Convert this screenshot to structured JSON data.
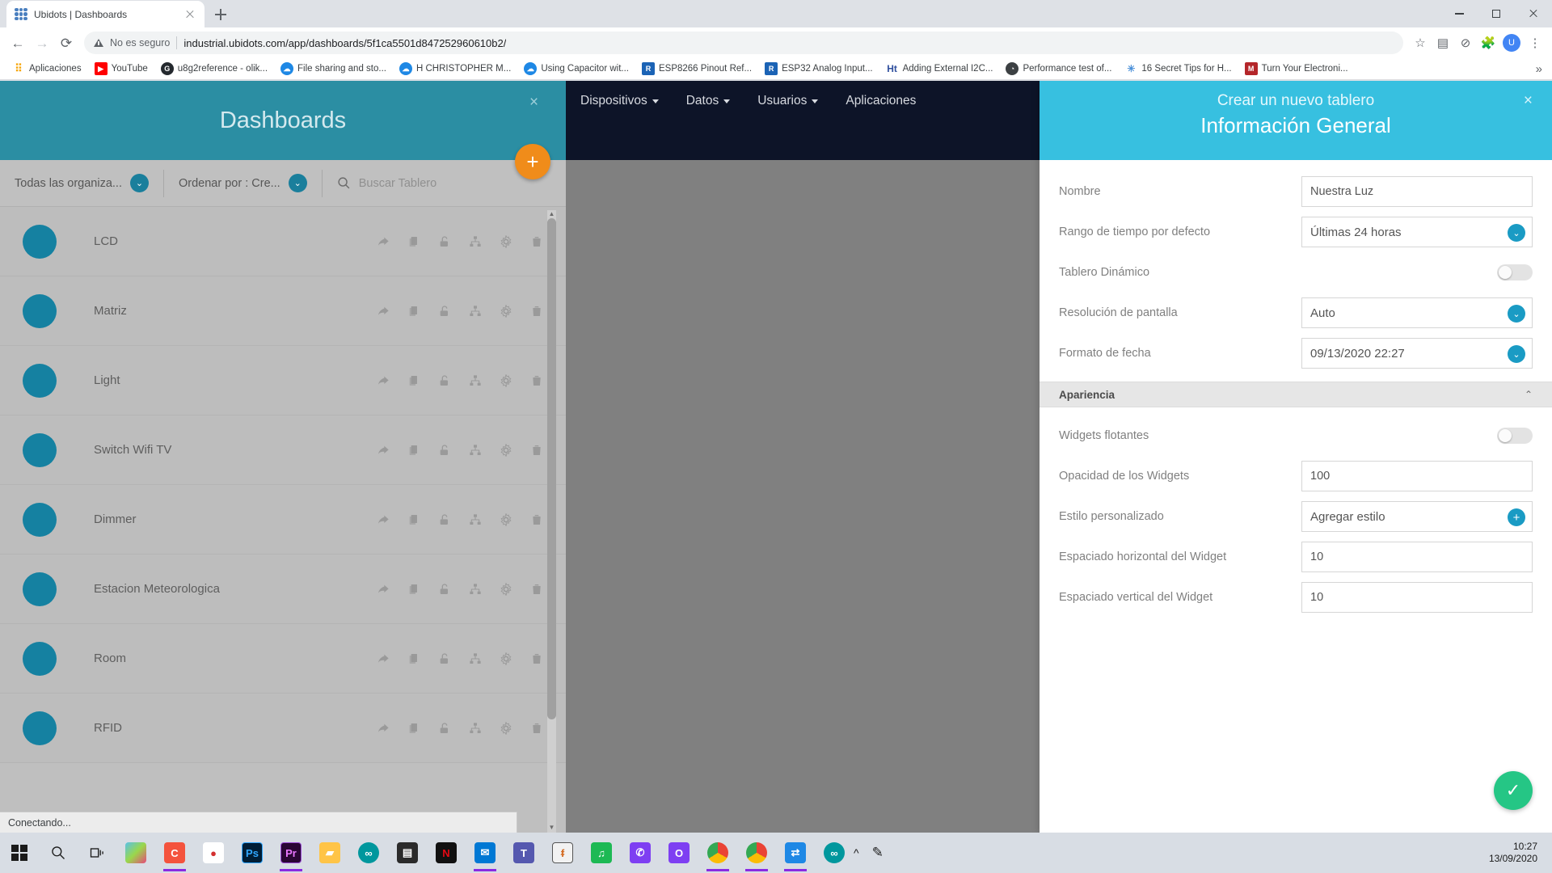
{
  "browser": {
    "tab": {
      "title": "Ubidots | Dashboards",
      "favicon": "ubidots-dots-icon",
      "close": "×"
    },
    "new_tab_tooltip": "+",
    "window_controls": {
      "minimize": "minimize-icon",
      "maximize": "maximize-icon",
      "close": "close-icon"
    },
    "omnibox": {
      "security_label": "No es seguro",
      "url": "industrial.ubidots.com/app/dashboards/5f1ca5501d847252960610b2/",
      "star": "☆",
      "avatar_initial": "U"
    },
    "bookmarks": [
      {
        "label": "Aplicaciones",
        "icon": "apps-grid-icon",
        "color": "#f6a609"
      },
      {
        "label": "YouTube",
        "icon": "youtube-icon",
        "color": "#ff0000"
      },
      {
        "label": "u8g2reference - olik...",
        "icon": "github-icon",
        "color": "#24292e"
      },
      {
        "label": "File sharing and sto...",
        "icon": "cloud-icon",
        "color": "#1e88e5"
      },
      {
        "label": "H CHRISTOPHER M...",
        "icon": "cloud-icon",
        "color": "#1e88e5"
      },
      {
        "label": "Using Capacitor wit...",
        "icon": "cloud-icon",
        "color": "#1e88e5"
      },
      {
        "label": "ESP8266 Pinout Ref...",
        "icon": "page-icon",
        "color": "#1b63b5"
      },
      {
        "label": "ESP32 Analog Input...",
        "icon": "page-icon",
        "color": "#1b63b5"
      },
      {
        "label": "Adding External I2C...",
        "icon": "h-icon",
        "color": "#2f4f9e"
      },
      {
        "label": "Performance test of...",
        "icon": "circle-icon",
        "color": "#3c4043"
      },
      {
        "label": "16 Secret Tips for H...",
        "icon": "star-burst-icon",
        "color": "#4a90d9"
      },
      {
        "label": "Turn Your Electroni...",
        "icon": "m-icon",
        "color": "#b4262a"
      }
    ],
    "overflow": "»"
  },
  "page": {
    "navbar": {
      "items": [
        {
          "label": "Dispositivos",
          "has_caret": true
        },
        {
          "label": "Datos",
          "has_caret": true
        },
        {
          "label": "Usuarios",
          "has_caret": true
        },
        {
          "label": "Aplicaciones",
          "has_caret": false
        }
      ]
    },
    "drawer": {
      "title": "Dashboards",
      "close": "×",
      "add_button": "+",
      "filters": [
        {
          "label": "Todas las organiza...",
          "chevron": "⌄"
        },
        {
          "label": "Ordenar por : Cre...",
          "chevron": "⌄"
        }
      ],
      "search": {
        "placeholder": "Buscar Tablero",
        "value": "",
        "icon": "search-icon"
      },
      "row_actions": [
        "share-icon",
        "duplicate-icon",
        "unlock-icon",
        "hierarchy-icon",
        "gear-icon",
        "trash-icon"
      ],
      "items": [
        {
          "name": "LCD"
        },
        {
          "name": "Matriz"
        },
        {
          "name": "Light"
        },
        {
          "name": "Switch Wifi TV"
        },
        {
          "name": "Dimmer"
        },
        {
          "name": "Estacion Meteorologica"
        },
        {
          "name": "Room"
        },
        {
          "name": "RFID"
        }
      ]
    },
    "right_panel": {
      "subtitle": "Crear un nuevo tablero",
      "title": "Información General",
      "close": "×",
      "fields": [
        {
          "label": "Nombre",
          "type": "text",
          "value": "Nuestra Luz"
        },
        {
          "label": "Rango de tiempo por defecto",
          "type": "select",
          "value": "Últimas 24 horas"
        },
        {
          "label": "Tablero Dinámico",
          "type": "toggle",
          "value": "off"
        },
        {
          "label": "Resolución de pantalla",
          "type": "select",
          "value": "Auto"
        },
        {
          "label": "Formato de fecha",
          "type": "select",
          "value": "09/13/2020 22:27"
        }
      ],
      "section": {
        "title": "Apariencia",
        "chevron": "⌃"
      },
      "appearance_fields": [
        {
          "label": "Widgets flotantes",
          "type": "toggle",
          "value": "off"
        },
        {
          "label": "Opacidad de los Widgets",
          "type": "text",
          "value": "100"
        },
        {
          "label": "Estilo personalizado",
          "type": "add",
          "value": "Agregar estilo"
        },
        {
          "label": "Espaciado horizontal del Widget",
          "type": "text",
          "value": "10"
        },
        {
          "label": "Espaciado vertical del Widget",
          "type": "text",
          "value": "10"
        }
      ],
      "save_button": "✓"
    },
    "status_text": "Conectando..."
  },
  "taskbar": {
    "start": "windows-start-icon",
    "search": "search-icon",
    "task_view": "task-view-icon",
    "apps": [
      {
        "name": "paint-3d",
        "label": "",
        "color": "#ffffff",
        "active": false
      },
      {
        "name": "c-app",
        "label": "C",
        "color": "#f4533d",
        "active": true
      },
      {
        "name": "red-drop-app",
        "label": "",
        "color": "#ffffff",
        "active": false
      },
      {
        "name": "photoshop",
        "label": "Ps",
        "color": "#001e36",
        "active": false
      },
      {
        "name": "premiere",
        "label": "Pr",
        "color": "#2a0634",
        "active": true
      },
      {
        "name": "file-explorer",
        "label": "",
        "color": "#ffc447",
        "active": false
      },
      {
        "name": "arduino",
        "label": "∞",
        "color": "#00979d",
        "active": false
      },
      {
        "name": "microsoft-store",
        "label": "",
        "color": "#2b2b2b",
        "active": false
      },
      {
        "name": "netflix",
        "label": "N",
        "color": "#111111",
        "active": false
      },
      {
        "name": "mail",
        "label": "",
        "color": "#0078d4",
        "active": true
      },
      {
        "name": "teams",
        "label": "T",
        "color": "#5558af",
        "active": false
      },
      {
        "name": "fritzing",
        "label": "",
        "color": "#f2f2f2",
        "active": false
      },
      {
        "name": "spotify",
        "label": "",
        "color": "#1db954",
        "active": false
      },
      {
        "name": "whatsapp",
        "label": "",
        "color": "#7e3ff2",
        "active": false
      },
      {
        "name": "outlook-app",
        "label": "O",
        "color": "#7e3ff2",
        "active": false
      },
      {
        "name": "chrome",
        "label": "",
        "color": "#ffffff",
        "active": true
      },
      {
        "name": "chrome-2",
        "label": "",
        "color": "#ffffff",
        "active": true
      },
      {
        "name": "teamviewer",
        "label": "",
        "color": "#1e88e5",
        "active": false
      },
      {
        "name": "arduino-2",
        "label": "∞",
        "color": "#00979d",
        "active": false
      }
    ],
    "pen_icon": "pen-icon",
    "time": "10:27",
    "date": "13/09/2020",
    "notifications": "notification-icon"
  },
  "colors": {
    "drawer_header": "#2b8ea3",
    "panel_header": "#37c0e0",
    "nav_dark": "#0d1428",
    "accent_blue": "#1a9bc4",
    "save_green": "#25c685",
    "fab_orange": "#f08c1a"
  }
}
